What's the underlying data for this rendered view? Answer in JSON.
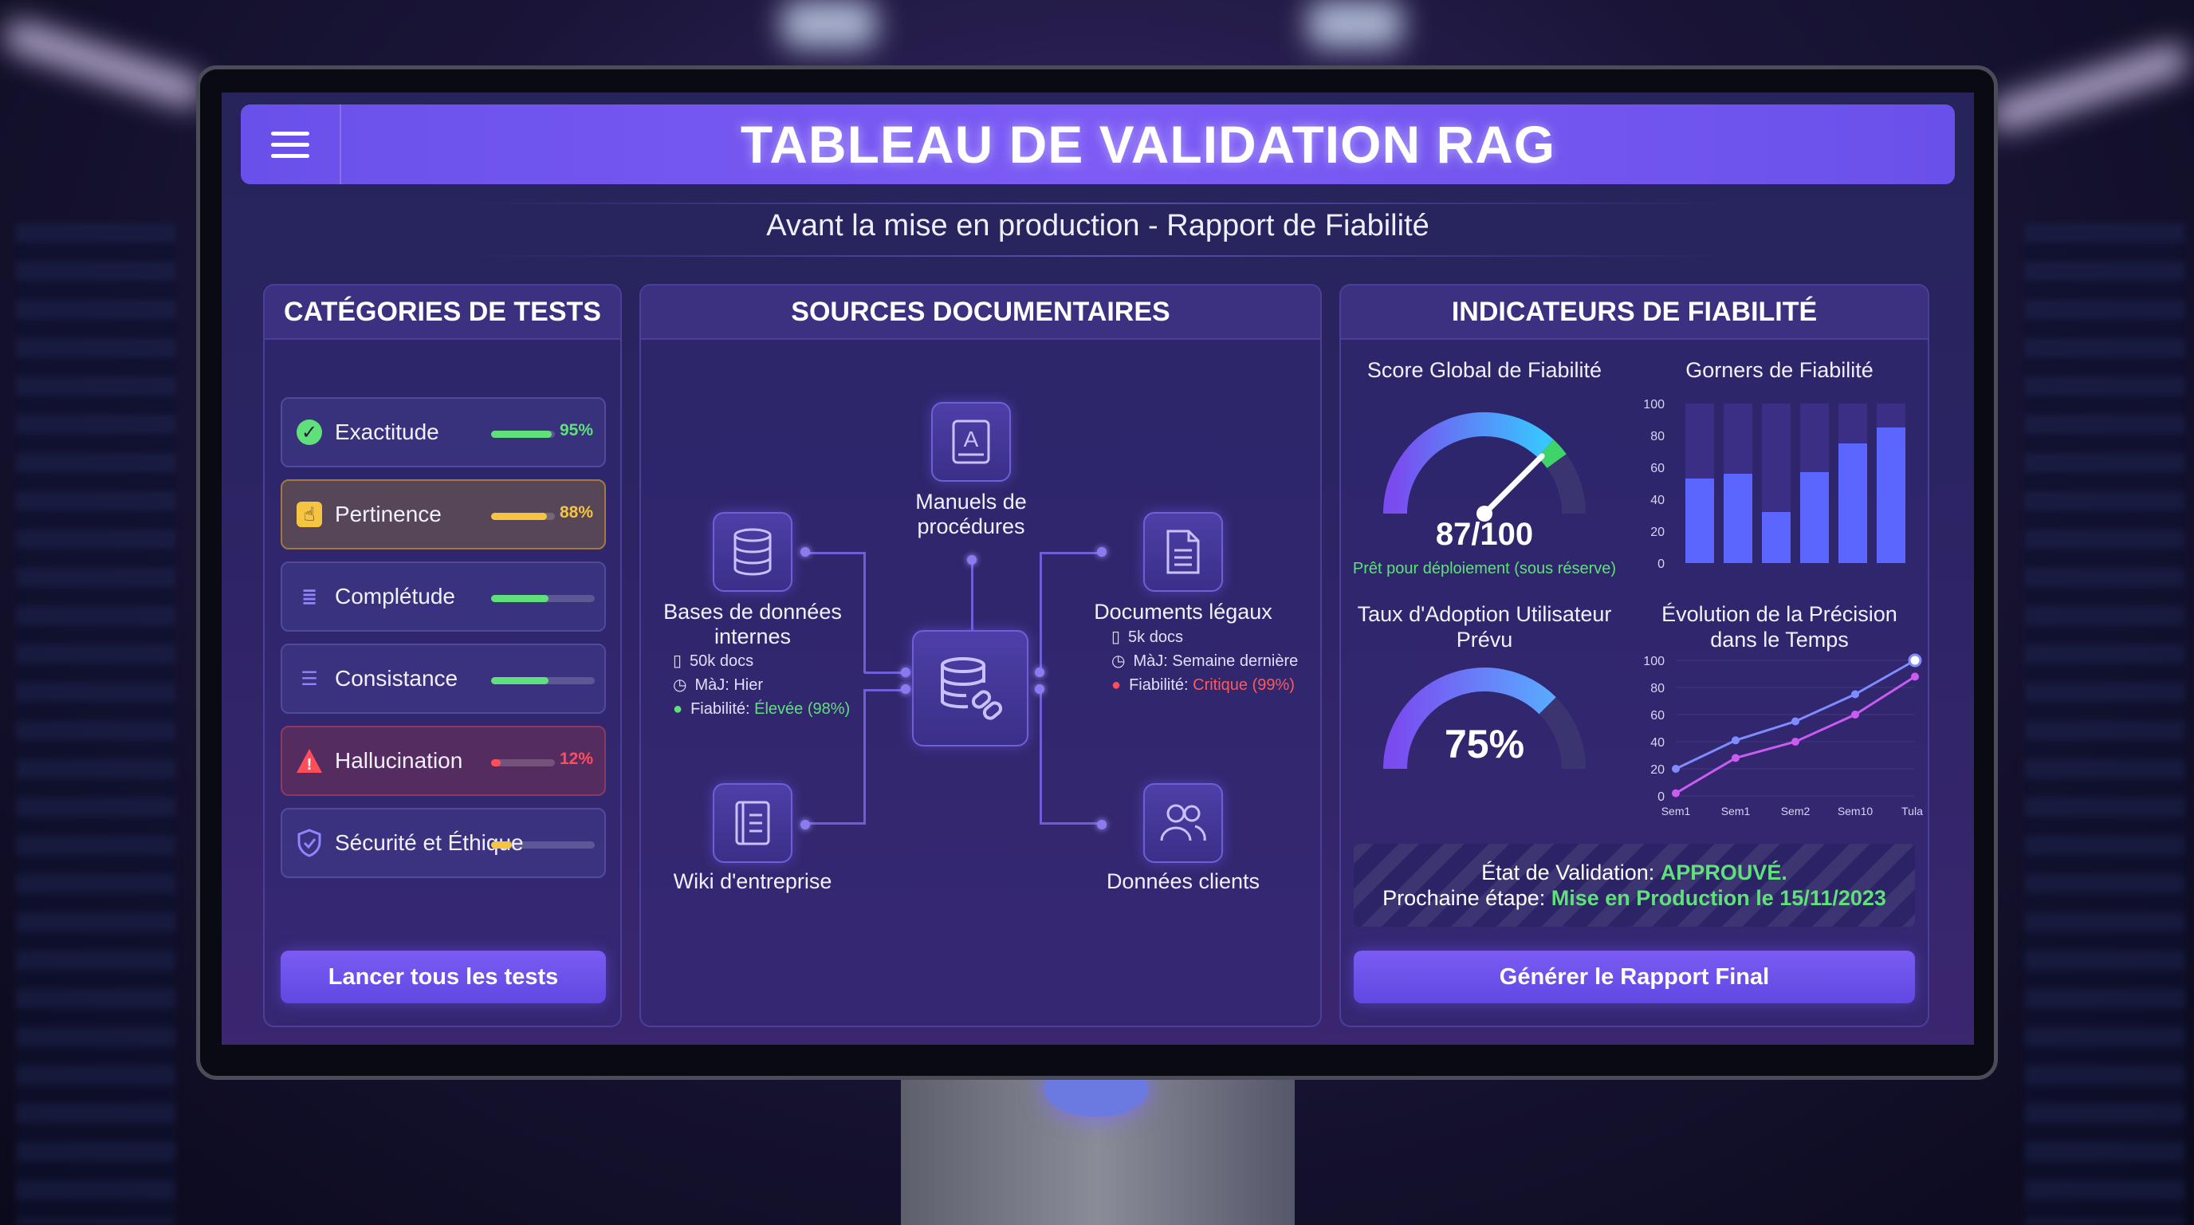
{
  "header": {
    "title": "TABLEAU DE VALIDATION RAG",
    "subtitle": "Avant la mise en production - Rapport de Fiabilité"
  },
  "colors": {
    "accent": "#7d5cf5",
    "green": "#5fe07a",
    "yellow": "#f5c542",
    "red": "#ff4d5a",
    "panel_border": "#4b3f98"
  },
  "tests": {
    "heading": "CATÉGORIES DE TESTS",
    "items": [
      {
        "label": "Exactitude",
        "icon": "check-circle-icon",
        "level": 0.95,
        "pct": "95%",
        "color": "#5fe07a"
      },
      {
        "label": "Pertinence",
        "icon": "pointer-icon",
        "level": 0.88,
        "pct": "88%",
        "color": "#f5c542"
      },
      {
        "label": "Complétude",
        "icon": "document-icon",
        "level": 0.55,
        "pct": "",
        "color": "#5fe07a"
      },
      {
        "label": "Consistance",
        "icon": "list-icon",
        "level": 0.55,
        "pct": "",
        "color": "#5fe07a"
      },
      {
        "label": "Hallucination",
        "icon": "warning-icon",
        "level": 0.12,
        "pct": "12%",
        "color": "#ff4d5a"
      },
      {
        "label": "Sécurité et Éthique",
        "icon": "shield-icon",
        "level": 0.2,
        "pct": "",
        "color": "#f5c542"
      }
    ],
    "run_button": "Lancer tous les tests"
  },
  "sources": {
    "heading": "SOURCES DOCUMENTAIRES",
    "manuals": {
      "label": "Manuels de procédures",
      "icon": "book-icon"
    },
    "databases": {
      "label": "Bases de données internes",
      "icon": "database-icon",
      "docs": "50k docs",
      "update": "MàJ: Hier",
      "reliability_prefix": "Fiabilité: ",
      "reliability_value": "Élevée (98%)"
    },
    "legal": {
      "label": "Documents légaux",
      "icon": "file-icon",
      "docs": "5k docs",
      "update": "MàJ: Semaine dernière",
      "reliability_prefix": "Fiabilité: ",
      "reliability_value": "Critique (99%)"
    },
    "wiki": {
      "label": "Wiki d'entreprise",
      "icon": "notebook-icon"
    },
    "clients": {
      "label": "Données clients",
      "icon": "users-icon"
    },
    "hub": {
      "icon": "database-link-icon"
    }
  },
  "indicators": {
    "heading": "INDICATEURS DE FIABILITÉ",
    "score": {
      "title": "Score Global de Fiabilité",
      "value": "87/100",
      "level": 0.87,
      "caption": "Prêt pour déploiement (sous réserve)"
    },
    "adoption": {
      "title": "Taux d'Adoption Utilisateur Prévu",
      "value": "75%",
      "level": 0.75
    },
    "status": {
      "prefix": "État de Validation: ",
      "value": "APPROUVÉ.",
      "next_prefix": "Prochaine étape: ",
      "next_value": "Mise en Production le 15/11/2023"
    },
    "report_button": "Générer le Rapport Final"
  },
  "chart_data": [
    {
      "type": "bar",
      "title": "Gorners de Fiabilité",
      "ylim": [
        0,
        100
      ],
      "yticks": [
        "0",
        "20",
        "40",
        "60",
        "80",
        "100"
      ],
      "series": [
        {
          "values": [
            53,
            56,
            32,
            57,
            75,
            85
          ]
        }
      ]
    },
    {
      "type": "line",
      "title": "Évolution de la Précision dans le Temps",
      "ylim": [
        0,
        100
      ],
      "yticks": [
        "0",
        "20",
        "40",
        "60",
        "80",
        "100"
      ],
      "categories": [
        "Sem1",
        "Sem1",
        "Sem2",
        "Sem10",
        "Tulac"
      ],
      "series": [
        {
          "values": [
            20,
            41,
            55,
            75,
            100
          ]
        },
        {
          "values": [
            2,
            28,
            40,
            60,
            88
          ]
        }
      ]
    }
  ]
}
